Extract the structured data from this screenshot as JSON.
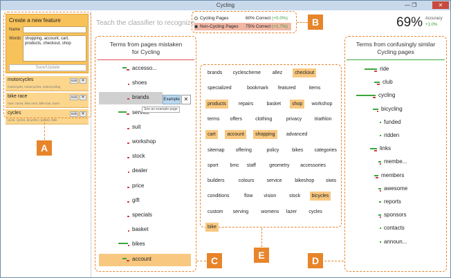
{
  "window": {
    "title": "Cycling",
    "controls": "—   ❐",
    "close": "✕"
  },
  "create": {
    "title": "Create a new feature",
    "name_label": "Name",
    "name_value": "",
    "words_label": "Words",
    "words_value": "shopping, account, cart, products, checkout, shop",
    "save_label": "Save/Update"
  },
  "features": [
    {
      "name": "motorcycles",
      "words": "motorcycle, motorcycles, motorcycling",
      "edit": "Edit",
      "remove": "✕"
    },
    {
      "name": "bike race",
      "words": "race, races, bike race, bike tour, tours",
      "edit": "Edit",
      "remove": "✕"
    },
    {
      "name": "cycles",
      "words": "cycle, cycles, bicycles, cyclists, bike",
      "edit": "Edit",
      "remove": "✕"
    }
  ],
  "prompt": "Teach the classifier to recognize...",
  "stats": [
    {
      "class": "Cycling Pages",
      "pct": "60%",
      "label": "Correct",
      "gain": "(+0.0%)"
    },
    {
      "class": "Non-Cycling Pages",
      "pct": "75%",
      "label": "Correct",
      "gain": "(+1.7%)"
    }
  ],
  "accuracy": {
    "value": "69%",
    "label": "Accuracy",
    "gain": "+1.0%"
  },
  "callouts": {
    "a": "A",
    "b": "B",
    "c": "C",
    "d": "D",
    "e": "E"
  },
  "left_column": {
    "title_line1": "Terms from pages mistaken",
    "title_line2": "for Cycling",
    "terms": [
      "accesso...",
      "shoes",
      "brands",
      "service",
      "suit",
      "workshop",
      "stock",
      "dealer",
      "price",
      "gift",
      "specials",
      "basket",
      "bikes",
      "account"
    ],
    "example_label": "Example",
    "example_close": "✕",
    "tooltip": "See an example page"
  },
  "cloud": {
    "rows": [
      [
        {
          "t": "brands",
          "h": false
        },
        {
          "t": "cyclescheme",
          "h": false
        },
        {
          "t": "allez",
          "h": false
        },
        {
          "t": "checkout",
          "h": true
        }
      ],
      [
        {
          "t": "specialized",
          "h": false
        },
        {
          "t": "bookmark",
          "h": false
        },
        {
          "t": "featured",
          "h": false
        },
        {
          "t": "items",
          "h": false
        }
      ],
      [
        {
          "t": "products",
          "h": true
        },
        {
          "t": "repairs",
          "h": false
        },
        {
          "t": "basket",
          "h": false
        },
        {
          "t": "shop",
          "h": true
        },
        {
          "t": "workshop",
          "h": false
        }
      ],
      [
        {
          "t": "terms",
          "h": false
        },
        {
          "t": "offers",
          "h": false
        },
        {
          "t": "clothing",
          "h": false
        },
        {
          "t": "privacy",
          "h": false
        },
        {
          "t": "triathlon",
          "h": false
        }
      ],
      [
        {
          "t": "cart",
          "h": true
        },
        {
          "t": "account",
          "h": true
        },
        {
          "t": "shopping",
          "h": true
        },
        {
          "t": "advanced",
          "h": false
        }
      ],
      [
        {
          "t": "sitemap",
          "h": false
        },
        {
          "t": "offering",
          "h": false
        },
        {
          "t": "policy",
          "h": false
        },
        {
          "t": "bikes",
          "h": false
        },
        {
          "t": "categories",
          "h": false
        }
      ],
      [
        {
          "t": "sport",
          "h": false
        },
        {
          "t": "bmc",
          "h": false
        },
        {
          "t": "staff",
          "h": false
        },
        {
          "t": "geometry",
          "h": false
        },
        {
          "t": "accessories",
          "h": false
        }
      ],
      [
        {
          "t": "builders",
          "h": false
        },
        {
          "t": "colours",
          "h": false
        },
        {
          "t": "service",
          "h": false
        },
        {
          "t": "bikeshop",
          "h": false
        },
        {
          "t": "siwis",
          "h": false
        }
      ],
      [
        {
          "t": "conditions",
          "h": false
        },
        {
          "t": "flow",
          "h": false
        },
        {
          "t": "vision",
          "h": false
        },
        {
          "t": "stock",
          "h": false
        },
        {
          "t": "bicycles",
          "h": true
        }
      ],
      [
        {
          "t": "custom",
          "h": false
        },
        {
          "t": "serving",
          "h": false
        },
        {
          "t": "womens",
          "h": false
        },
        {
          "t": "lazer",
          "h": false
        },
        {
          "t": "cycles",
          "h": false
        }
      ],
      [
        {
          "t": "bike",
          "h": true
        }
      ]
    ]
  },
  "right_column": {
    "title_line1": "Terms from confusingly similar",
    "title_line2": "Cycling pages",
    "terms": [
      "ride",
      "club",
      "cycling",
      "bicycling",
      "funded",
      "ridden",
      "links",
      "membe...",
      "members",
      "awesome",
      "reports",
      "sponsors",
      "contacts",
      "announ..."
    ]
  },
  "colors": {
    "accent": "#e8842a",
    "green": "#3aa53a",
    "red": "#d04040",
    "highlight": "#f8c880"
  }
}
